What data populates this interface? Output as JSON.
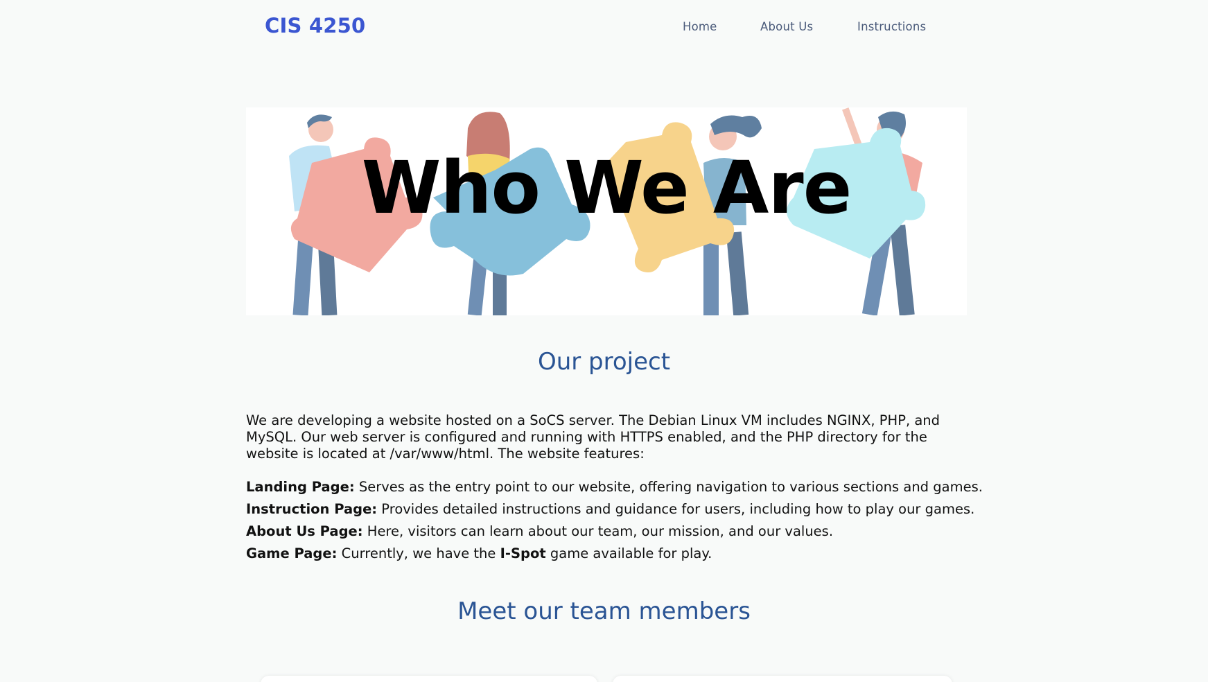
{
  "nav": {
    "brand": "CIS 4250",
    "links": [
      "Home",
      "About Us",
      "Instructions"
    ]
  },
  "hero": {
    "title": "Who We Are",
    "illustration": "people-holding-puzzle-pieces"
  },
  "project": {
    "title": "Our project",
    "intro": "We are developing a website hosted on a SoCS server. The Debian Linux VM includes NGINX, PHP, and MySQL. Our web server is configured and running with HTTPS enabled, and the PHP directory for the website is located at /var/www/html. The website features:",
    "features": [
      {
        "label": "Landing Page:",
        "text": " Serves as the entry point to our website, offering navigation to various sections and games."
      },
      {
        "label": "Instruction Page:",
        "text": " Provides detailed instructions and guidance for users, including how to play our games."
      },
      {
        "label": "About Us Page:",
        "text": " Here, visitors can learn about our team, our mission, and our values."
      },
      {
        "label": "Game Page:",
        "text_before": " Currently, we have the ",
        "highlight": "I-Spot",
        "text_after": " game available for play."
      }
    ]
  },
  "team": {
    "title": "Meet our team members"
  },
  "colors": {
    "brand": "#3b56d1",
    "heading": "#2a5494",
    "nav_link": "#4a5a7a",
    "background": "#f8faf9"
  }
}
